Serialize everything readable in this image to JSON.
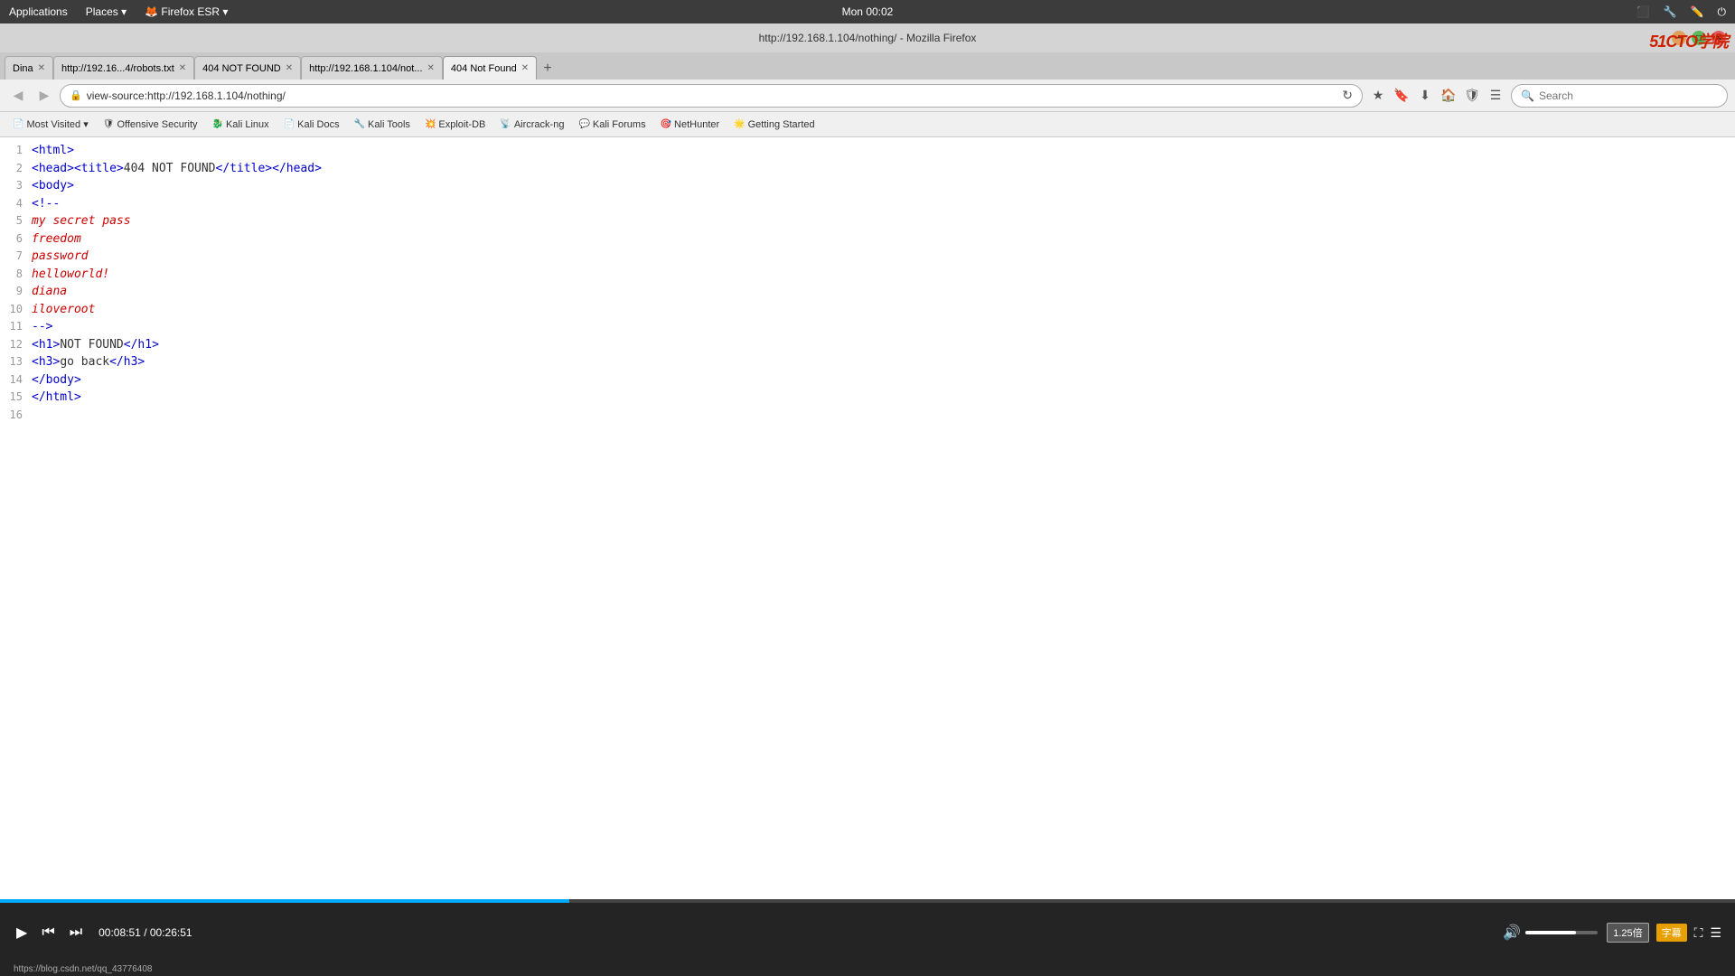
{
  "system_bar": {
    "app_menu": "Applications",
    "places_menu": "Places",
    "browser_menu": "Firefox ESR",
    "clock": "Mon 00:02"
  },
  "browser": {
    "title": "http://192.168.1.104/nothing/ - Mozilla Firefox",
    "logo": "51CTO学院"
  },
  "tabs": [
    {
      "label": "Dina",
      "active": false,
      "url": "Dina"
    },
    {
      "label": "http://192.16...4/robots.txt",
      "active": false
    },
    {
      "label": "404 NOT FOUND",
      "active": false
    },
    {
      "label": "http://192.168.1.104/not...",
      "active": false
    },
    {
      "label": "404 Not Found",
      "active": true
    }
  ],
  "nav": {
    "url": "view-source:http://192.168.1.104/nothing/",
    "search_placeholder": "Search"
  },
  "bookmarks": [
    {
      "label": "Most Visited"
    },
    {
      "label": "Offensive Security"
    },
    {
      "label": "Kali Linux"
    },
    {
      "label": "Kali Docs"
    },
    {
      "label": "Kali Tools"
    },
    {
      "label": "Exploit-DB"
    },
    {
      "label": "Aircrack-ng"
    },
    {
      "label": "Kali Forums"
    },
    {
      "label": "NetHunter"
    },
    {
      "label": "Getting Started"
    }
  ],
  "source_lines": [
    {
      "num": 1,
      "html": "<span class='tag'>&lt;html&gt;</span>"
    },
    {
      "num": 2,
      "html": "<span class='tag'>&lt;head&gt;&lt;title&gt;</span><span class='text-content'>404 NOT FOUND</span><span class='tag'>&lt;/title&gt;&lt;/head&gt;</span>"
    },
    {
      "num": 3,
      "html": "<span class='tag'>&lt;body&gt;</span>"
    },
    {
      "num": 4,
      "html": "<span class='tag'>&lt;!--</span>"
    },
    {
      "num": 5,
      "html": "<span class='italic-red'>my secret pass</span>"
    },
    {
      "num": 6,
      "html": "<span class='italic-red'>freedom</span>"
    },
    {
      "num": 7,
      "html": "<span class='italic-red'>password</span>"
    },
    {
      "num": 8,
      "html": "<span class='italic-red'>helloworld!</span>"
    },
    {
      "num": 9,
      "html": "<span class='italic-red'>diana</span>"
    },
    {
      "num": 10,
      "html": "<span class='italic-red'>iloveroot</span>"
    },
    {
      "num": 11,
      "html": "<span class='tag'>--&gt;</span>"
    },
    {
      "num": 12,
      "html": "<span class='tag'>&lt;h1&gt;</span><span class='text-content'>NOT FOUND</span><span class='tag'>&lt;/h1&gt;</span>"
    },
    {
      "num": 13,
      "html": "<span class='tag'>&lt;h3&gt;</span><span class='text-content'>go back</span><span class='tag'>&lt;/h3&gt;</span>"
    },
    {
      "num": 14,
      "html": "<span class='tag'>&lt;/body&gt;</span>"
    },
    {
      "num": 15,
      "html": "<span class='tag'>&lt;/html&gt;</span>"
    },
    {
      "num": 16,
      "html": ""
    }
  ],
  "video": {
    "current_time": "00:08:51",
    "total_time": "00:26:51",
    "speed": "1.25倍",
    "speed_active": "1.25倍",
    "url_bottom": "https://blog.csdn.net/qq_43776408"
  }
}
